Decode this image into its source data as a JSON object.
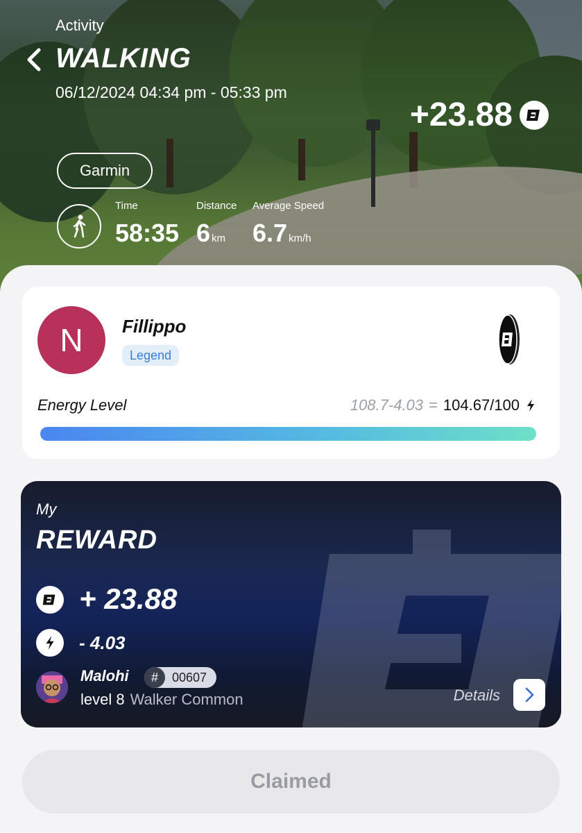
{
  "header": {
    "section_label": "Activity",
    "title": "WALKING",
    "datetime": "06/12/2024 04:34 pm - 05:33 pm",
    "earned": "+23.88",
    "device": "Garmin"
  },
  "stats": [
    {
      "label": "Time",
      "value": "58:35",
      "unit": ""
    },
    {
      "label": "Distance",
      "value": "6",
      "unit": "km"
    },
    {
      "label": "Average Speed",
      "value": "6.7",
      "unit": "km/h"
    }
  ],
  "profile": {
    "avatar_letter": "N",
    "avatar_color": "#b8315a",
    "name": "Fillippo",
    "rank": "Legend",
    "energy_label": "Energy Level",
    "energy_calc": "108.7-4.03",
    "energy_equals": "=",
    "energy_result": "104.67/100",
    "energy_fill": 1.0
  },
  "reward": {
    "my_label": "My",
    "title": "REWARD",
    "coin_amount": "+ 23.88",
    "energy_amount": "- 4.03",
    "nft_name": "Malohi",
    "nft_hash": "#",
    "nft_id": "00607",
    "level": "level 8",
    "tier": "Walker Common",
    "details_label": "Details"
  },
  "claim_button": "Claimed",
  "colors": {
    "accent_blue": "#3a7bd5",
    "card_dark": "#13235a",
    "claim_bg": "#e8e8ea"
  }
}
